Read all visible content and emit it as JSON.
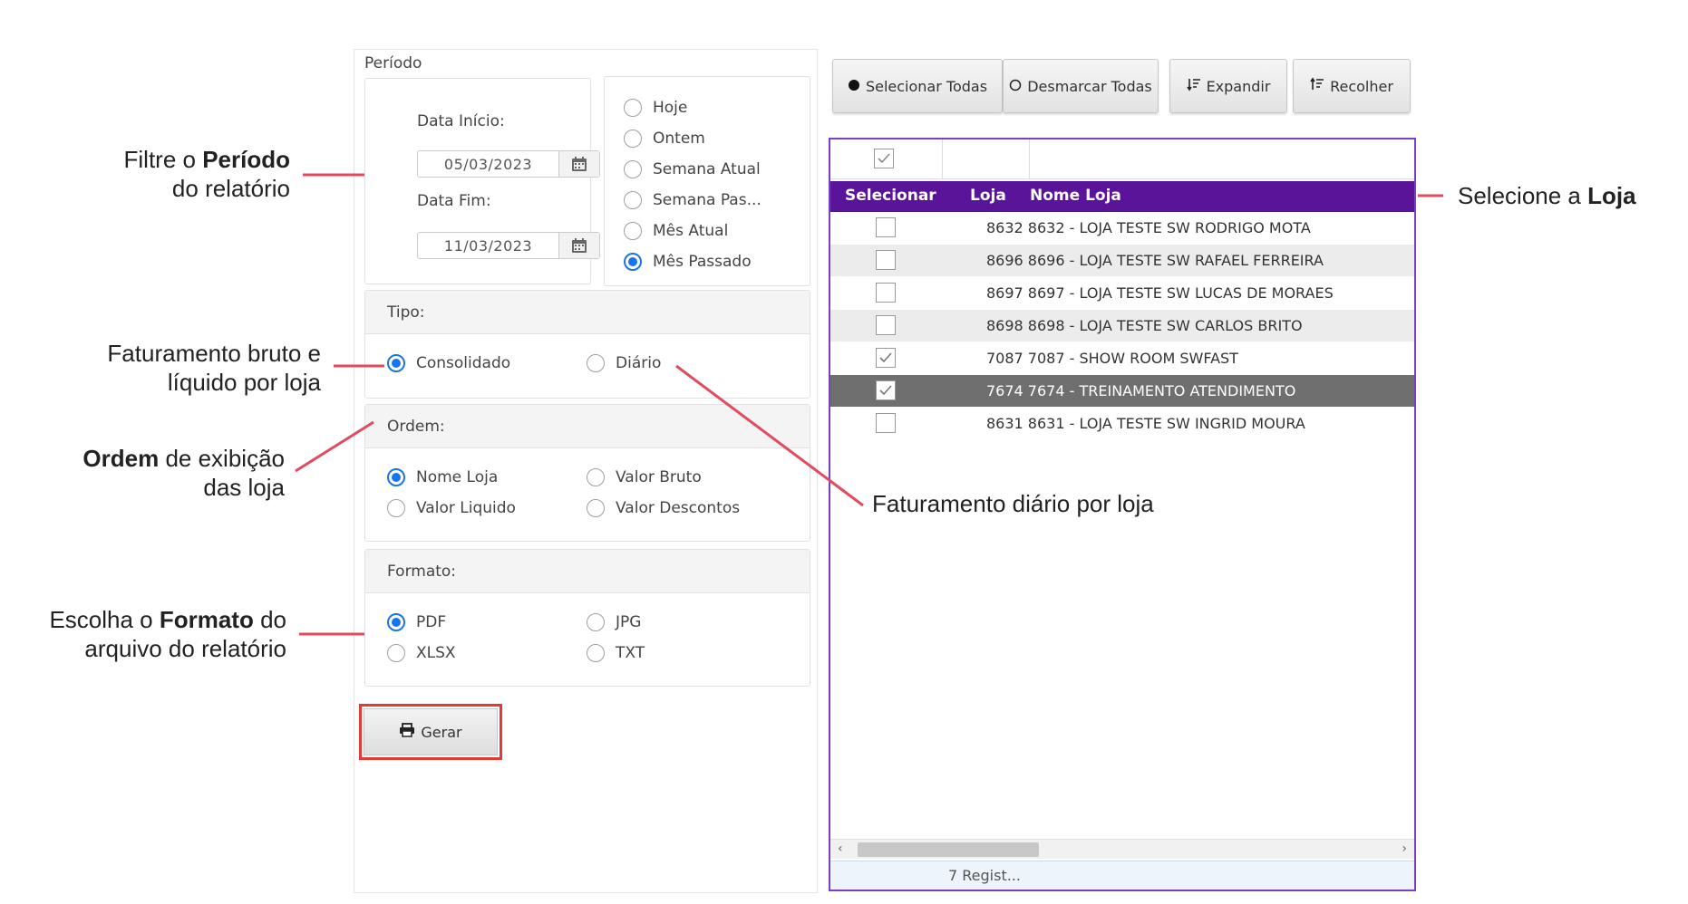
{
  "periodo": {
    "title": "Período",
    "data_inicio_label": "Data Início:",
    "data_inicio_value": "05/03/2023",
    "data_fim_label": "Data Fim:",
    "data_fim_value": "11/03/2023",
    "quick_options": [
      {
        "label": "Hoje",
        "selected": false
      },
      {
        "label": "Ontem",
        "selected": false
      },
      {
        "label": "Semana Atual",
        "selected": false
      },
      {
        "label": "Semana Pas...",
        "selected": false
      },
      {
        "label": "Mês Atual",
        "selected": false
      },
      {
        "label": "Mês Passado",
        "selected": true
      }
    ]
  },
  "tipo": {
    "title": "Tipo:",
    "options": [
      {
        "label": "Consolidado",
        "selected": true
      },
      {
        "label": "Diário",
        "selected": false
      }
    ]
  },
  "ordem": {
    "title": "Ordem:",
    "options": [
      {
        "label": "Nome Loja",
        "selected": true
      },
      {
        "label": "Valor Bruto",
        "selected": false
      },
      {
        "label": "Valor Liquido",
        "selected": false
      },
      {
        "label": "Valor Descontos",
        "selected": false
      }
    ]
  },
  "formato": {
    "title": "Formato:",
    "options": [
      {
        "label": "PDF",
        "selected": true
      },
      {
        "label": "JPG",
        "selected": false
      },
      {
        "label": "XLSX",
        "selected": false
      },
      {
        "label": "TXT",
        "selected": false
      }
    ]
  },
  "gerar_label": "Gerar",
  "toolbar": {
    "selecionar_todas": "Selecionar Todas",
    "desmarcar_todas": "Desmarcar Todas",
    "expandir": "Expandir",
    "recolher": "Recolher"
  },
  "grid": {
    "headers": {
      "selecionar": "Selecionar",
      "loja": "Loja",
      "nome_loja": "Nome Loja"
    },
    "rows": [
      {
        "text": "8632 8632 - LOJA TESTE SW RODRIGO MOTA",
        "checked": false
      },
      {
        "text": "8696 8696 - LOJA TESTE SW RAFAEL FERREIRA",
        "checked": false
      },
      {
        "text": "8697 8697 - LOJA TESTE SW LUCAS DE MORAES",
        "checked": false
      },
      {
        "text": "8698 8698 - LOJA TESTE SW CARLOS BRITO",
        "checked": false
      },
      {
        "text": "7087 7087 - SHOW ROOM SWFAST",
        "checked": true
      },
      {
        "text": "7674 7674 - TREINAMENTO ATENDIMENTO",
        "checked": true
      },
      {
        "text": "8631 8631 - LOJA TESTE SW INGRID MOURA",
        "checked": false
      }
    ],
    "footer": "7 Regist..."
  },
  "annotations": {
    "periodo_a": "Filtre o ",
    "periodo_b": "Período",
    "periodo_c": "do relatório",
    "fat_a": "Faturamento bruto e",
    "fat_b": "líquido por loja",
    "ordem_a": "Ordem",
    "ordem_b": " de exibição",
    "ordem_c": "das loja",
    "formato_a": "Escolha o ",
    "formato_b": "Formato",
    "formato_c": " do",
    "formato_d": "arquivo do relatório",
    "loja_a": "Selecione a ",
    "loja_b": "Loja",
    "diario": "Faturamento diário por loja"
  },
  "colors": {
    "header": "#5a1499",
    "accent": "#1a73e8",
    "annotation_line": "#e24b5e",
    "highlight": "#e53935"
  }
}
